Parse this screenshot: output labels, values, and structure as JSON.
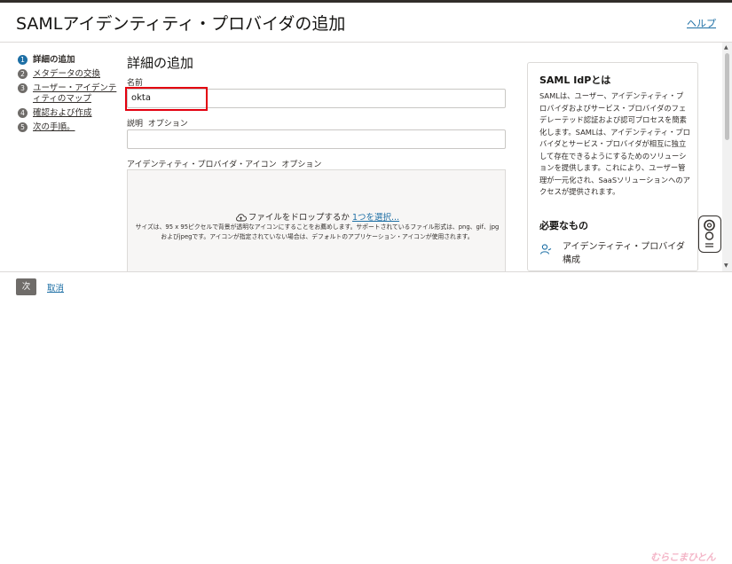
{
  "header": {
    "title": "SAMLアイデンティティ・プロバイダの追加",
    "help": "ヘルプ"
  },
  "steps": [
    {
      "num": "1",
      "label": "詳細の追加"
    },
    {
      "num": "2",
      "label": "メタデータの交換"
    },
    {
      "num": "3",
      "label": "ユーザー・アイデンティティのマップ"
    },
    {
      "num": "4",
      "label": "確認および作成"
    },
    {
      "num": "5",
      "label": "次の手順。"
    }
  ],
  "main": {
    "heading": "詳細の追加",
    "name_label": "名前",
    "name_value": "okta",
    "desc_label": "説明",
    "desc_optional": "オプション",
    "icon_label": "アイデンティティ・プロバイダ・アイコン",
    "icon_optional": "オプション",
    "drop_text": "ファイルをドロップするか",
    "drop_link": "1つを選択...",
    "drop_note_1": "サイズは、95 x 95ピクセルで背景が透明なアイコンにすることをお薦めします。サポートされているファイル形式は、png、gif、jpg",
    "drop_note_2": "およびjpegです。アイコンが指定されていない場合は、デフォルトのアプリケーション・アイコンが使用されます。"
  },
  "side": {
    "title": "SAML IdPとは",
    "body": "SAMLは、ユーザー、アイデンティティ・プロバイダおよびサービス・プロバイダのフェデレーテッド認証および認可プロセスを簡素化します。SAMLは、アイデンティティ・プロバイダとサービス・プロバイダが相互に独立して存在できるようにするためのソリューションを提供します。これにより、ユーザー管理が一元化され、SaaSソリューションへのアクセスが提供されます。",
    "needs_title": "必要なもの",
    "needs_item": "アイデンティティ・プロバイダ構成"
  },
  "footer": {
    "next": "次",
    "cancel": "取消"
  },
  "watermark": "むらこまひとん",
  "icons": {
    "upload": "upload-cloud-icon",
    "user": "user-icon",
    "help_widget": "support-widget-icon"
  },
  "colors": {
    "accent": "#1d6fa5",
    "highlight": "#e3000f",
    "button": "#6f6c69"
  }
}
